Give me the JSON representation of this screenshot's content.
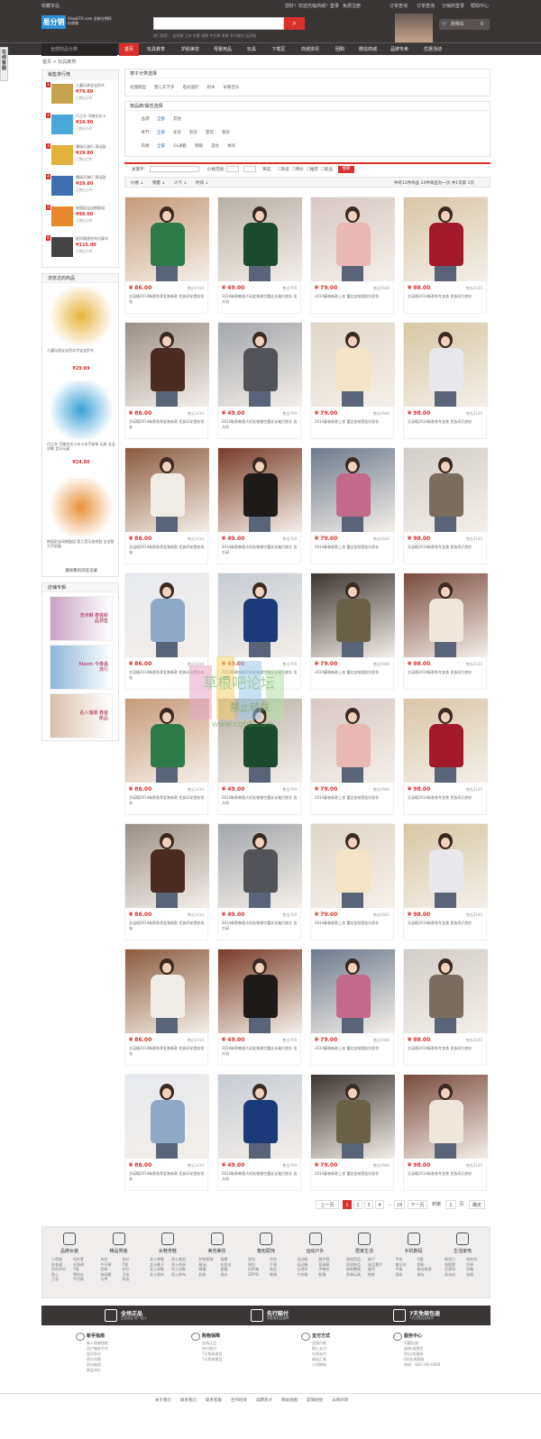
{
  "topbar": {
    "left": "收藏本站",
    "welcome": "您好！欢迎光临商城！",
    "login": "登录",
    "register": "免费注册",
    "order": "订单查询",
    "track": "订单查询",
    "distributor": "分销商登录",
    "help": "帮助中心"
  },
  "header": {
    "logo": "易分销",
    "logo_sub": "ShopEFX.com 全新分销科技商城",
    "search_placeholder": "",
    "hot_words": "热门搜索：  宝妈辅  卫衣  外套  裙装  牛仔裤  男装  多功能包  运动鞋",
    "cart_label": "购物车",
    "cart_count": "0"
  },
  "nav": {
    "category_label": "全部商品分类",
    "items": [
      "首页",
      "玩具教育",
      "护肤美容",
      "母婴用品",
      "玩具",
      "下载区",
      "商城资讯",
      "团购",
      "微信商城",
      "品牌专卖",
      "优惠活动"
    ]
  },
  "side_tab": "在线客服",
  "breadcrumb": "首页 > 玩具教育",
  "ranking": {
    "title": "销售排行榜",
    "items": [
      {
        "n": "1",
        "title": "儿童玩具宝宝积木",
        "price": "79.89",
        "sold": "已售出1件",
        "color": "#c6a24c"
      },
      {
        "n": "2",
        "title": "巧之木 可拖拉式小",
        "price": "24.90",
        "sold": "已售出1件",
        "color": "#4aa8d8"
      },
      {
        "n": "3",
        "title": "儒瑞天骑行 滑动鼓",
        "price": "29.80",
        "sold": "已售出1件",
        "color": "#e2b13a"
      },
      {
        "n": "4",
        "title": "儒瑞天骑行 滑动鼓",
        "price": "29.80",
        "sold": "已售出1件",
        "color": "#3e6fb0"
      },
      {
        "n": "5",
        "title": "南国彩宝动物鼓组",
        "price": "96.00",
        "sold": "已售出1件",
        "color": "#e88a2c"
      },
      {
        "n": "6",
        "title": "星阿模遥控车仿真车",
        "price": "115.00",
        "sold": "已售出1件",
        "color": "#444444"
      }
    ]
  },
  "viewed": {
    "title": "浏览过的商品",
    "items": [
      {
        "title": "儿童玩具宝宝积木字宝宝积木",
        "price": "¥29.89"
      },
      {
        "title": "巧之木 可拖拉式小木小木手敲琴 玩具 宝宝早教 音乐玩具",
        "price": "¥24.90"
      },
      {
        "title": "南国彩宝动物鼓组 婴儿音乐拍拍鼓 宝宝智力手拍鼓",
        "price": ""
      }
    ],
    "clear": "清除我的浏览记录"
  },
  "shops": {
    "title": "店铺专辑",
    "items": [
      "浩诗琳 春装新品预售",
      "fdaom 今春最流行",
      "名人瑞裳 春装新品"
    ]
  },
  "filter": {
    "cat_title": "按子分类选择",
    "cats": [
      "动漫模型",
      "婴儿车学步",
      "电动遥控",
      "积木",
      "早教音乐"
    ],
    "attr_title": "按品牌/属性选择",
    "rows": [
      {
        "k": "品牌：",
        "v": [
          "全部",
          "其他"
        ]
      },
      {
        "k": "季节：",
        "v": [
          "全部",
          "冬装",
          "秋装",
          "夏装",
          "春装"
        ]
      },
      {
        "k": "风格：",
        "v": [
          "全部",
          "OL通勤",
          "韩版",
          "淑女",
          "休闲"
        ]
      }
    ],
    "keyword_label": "关键字：",
    "price_label": "价格范围：",
    "filter_label": "筛选：",
    "checks": [
      "热卖",
      "特价",
      "推荐",
      "新品"
    ],
    "search_btn": "搜索"
  },
  "sort": {
    "items": [
      "价格",
      "销量",
      "人气",
      "时间"
    ],
    "summary": "共有12件商品 24件商品为一页 共1页第 1页"
  },
  "products": [
    {
      "price": "¥ 86.00",
      "sold": "售出1414",
      "desc": "艾诺格2014新款秋季女装新款 民族印花提花毛衣",
      "bg": "#c79a78",
      "cloth": "#2f7a4a"
    },
    {
      "price": "¥ 49.00",
      "sold": "售出769",
      "desc": "2014新款韩版大码女装镂空蕾丝长袖打底衫 女 大码",
      "bg": "#b8b0a6",
      "cloth": "#1c4a2f"
    },
    {
      "price": "¥ 79.00",
      "sold": "售出1640",
      "desc": "2014春装新款上衣 蕾丝女装宽松针织衫",
      "bg": "#d8c8c4",
      "cloth": "#e9b7b4"
    },
    {
      "price": "¥ 98.00",
      "sold": "售出2145",
      "desc": "艾诺格2014新款秋冬女装 民族风打底衫",
      "bg": "#d9c6a8",
      "cloth": "#a2182c"
    },
    {
      "price": "¥ 86.00",
      "sold": "售出1414",
      "desc": "艾诺格2014新款秋季女装新款 民族印花提花毛衣",
      "bg": "#9a8f86",
      "cloth": "#4a2c22"
    },
    {
      "price": "¥ 49.00",
      "sold": "售出769",
      "desc": "2014新款韩版大码女装镂空蕾丝长袖打底衫 女 大码",
      "bg": "#a3a6ab",
      "cloth": "#52545a"
    },
    {
      "price": "¥ 79.00",
      "sold": "售出1640",
      "desc": "2014春装新款上衣 蕾丝女装宽松针织衫",
      "bg": "#e0d6c8",
      "cloth": "#f2e4c4"
    },
    {
      "price": "¥ 98.00",
      "sold": "售出2145",
      "desc": "艾诺格2014新款秋冬女装 民族风打底衫",
      "bg": "#d6c7a4",
      "cloth": "#e8e8ec"
    },
    {
      "price": "¥ 86.00",
      "sold": "售出1414",
      "desc": "艾诺格2014新款秋季女装新款 民族印花提花毛衣",
      "bg": "#8c5a3c",
      "cloth": "#f0ece6"
    },
    {
      "price": "¥ 49.00",
      "sold": "售出769",
      "desc": "2014新款韩版大码女装镂空蕾丝长袖打底衫 女 大码",
      "bg": "#7a3c28",
      "cloth": "#1e1a1a"
    },
    {
      "price": "¥ 79.00",
      "sold": "售出1640",
      "desc": "2014春装新款上衣 蕾丝女装宽松针织衫",
      "bg": "#6d7a8c",
      "cloth": "#c26a8a"
    },
    {
      "price": "¥ 98.00",
      "sold": "售出2145",
      "desc": "艾诺格2014新款秋冬女装 民族风打底衫",
      "bg": "#d2cdc8",
      "cloth": "#7a6c5e"
    },
    {
      "price": "¥ 86.00",
      "sold": "售出1414",
      "desc": "艾诺格2014新款秋季女装新款 民族印花提花毛衣",
      "bg": "#e6e9ee",
      "cloth": "#8ea8c6"
    },
    {
      "price": "¥ 49.00",
      "sold": "售出769",
      "desc": "2014新款韩版大码女装镂空蕾丝长袖打底衫 女 大码",
      "bg": "#c6ccd4",
      "cloth": "#1c3a7a"
    },
    {
      "price": "¥ 79.00",
      "sold": "售出1640",
      "desc": "2014春装新款上衣 蕾丝女装宽松针织衫",
      "bg": "#3c3430",
      "cloth": "#6a6048"
    },
    {
      "price": "¥ 98.00",
      "sold": "售出2145",
      "desc": "艾诺格2014新款秋冬女装 民族风打底衫",
      "bg": "#7a4a3e",
      "cloth": "#efe6dc"
    },
    {
      "price": "¥ 86.00",
      "sold": "售出1414",
      "desc": "艾诺格2014新款秋季女装新款 民族印花提花毛衣",
      "bg": "#c79a78",
      "cloth": "#2f7a4a"
    },
    {
      "price": "¥ 49.00",
      "sold": "售出769",
      "desc": "2014新款韩版大码女装镂空蕾丝长袖打底衫 女 大码",
      "bg": "#b8b0a6",
      "cloth": "#1c4a2f"
    },
    {
      "price": "¥ 79.00",
      "sold": "售出1640",
      "desc": "2014春装新款上衣 蕾丝女装宽松针织衫",
      "bg": "#d8c8c4",
      "cloth": "#e9b7b4"
    },
    {
      "price": "¥ 98.00",
      "sold": "售出2145",
      "desc": "艾诺格2014新款秋冬女装 民族风打底衫",
      "bg": "#d9c6a8",
      "cloth": "#a2182c"
    },
    {
      "price": "¥ 86.00",
      "sold": "售出1414",
      "desc": "艾诺格2014新款秋季女装新款 民族印花提花毛衣",
      "bg": "#9a8f86",
      "cloth": "#4a2c22"
    },
    {
      "price": "¥ 49.00",
      "sold": "售出769",
      "desc": "2014新款韩版大码女装镂空蕾丝长袖打底衫 女 大码",
      "bg": "#a3a6ab",
      "cloth": "#52545a"
    },
    {
      "price": "¥ 79.00",
      "sold": "售出1640",
      "desc": "2014春装新款上衣 蕾丝女装宽松针织衫",
      "bg": "#e0d6c8",
      "cloth": "#f2e4c4"
    },
    {
      "price": "¥ 98.00",
      "sold": "售出2145",
      "desc": "艾诺格2014新款秋冬女装 民族风打底衫",
      "bg": "#d6c7a4",
      "cloth": "#e8e8ec"
    },
    {
      "price": "¥ 86.00",
      "sold": "售出1414",
      "desc": "艾诺格2014新款秋季女装新款 民族印花提花毛衣",
      "bg": "#8c5a3c",
      "cloth": "#f0ece6"
    },
    {
      "price": "¥ 49.00",
      "sold": "售出769",
      "desc": "2014新款韩版大码女装镂空蕾丝长袖打底衫 女 大码",
      "bg": "#7a3c28",
      "cloth": "#1e1a1a"
    },
    {
      "price": "¥ 79.00",
      "sold": "售出1640",
      "desc": "2014春装新款上衣 蕾丝女装宽松针织衫",
      "bg": "#6d7a8c",
      "cloth": "#c26a8a"
    },
    {
      "price": "¥ 98.00",
      "sold": "售出2145",
      "desc": "艾诺格2014新款秋冬女装 民族风打底衫",
      "bg": "#d2cdc8",
      "cloth": "#7a6c5e"
    },
    {
      "price": "¥ 86.00",
      "sold": "售出1414",
      "desc": "艾诺格2014新款秋季女装新款 民族印花提花毛衣",
      "bg": "#e6e9ee",
      "cloth": "#8ea8c6"
    },
    {
      "price": "¥ 49.00",
      "sold": "售出769",
      "desc": "2014新款韩版大码女装镂空蕾丝长袖打底衫 女 大码",
      "bg": "#c6ccd4",
      "cloth": "#1c3a7a"
    },
    {
      "price": "¥ 79.00",
      "sold": "售出1640",
      "desc": "2014春装新款上衣 蕾丝女装宽松针织衫",
      "bg": "#3c3430",
      "cloth": "#6a6048"
    },
    {
      "price": "¥ 98.00",
      "sold": "售出2145",
      "desc": "艾诺格2014新款秋冬女装 民族风打底衫",
      "bg": "#7a4a3e",
      "cloth": "#efe6dc"
    }
  ],
  "pager": {
    "prev": "上一页",
    "pages": [
      "1",
      "2",
      "3",
      "4"
    ],
    "ellipsis": "...",
    "last": "24",
    "next": "下一页",
    "goto": "到第",
    "page_input": "1",
    "page_unit": "页",
    "confirm": "确定"
  },
  "categories": [
    {
      "name": "品牌女装",
      "sub": [
        "小西装",
        "短外套",
        "连衣裙",
        "半身裙",
        "针织开衫",
        "T恤",
        "背心",
        "雪纺衫",
        "卫衣",
        "牛仔裤"
      ]
    },
    {
      "name": "精品男装",
      "sub": [
        "夹克",
        "毛衫",
        "牛仔裤",
        "T恤",
        "西装",
        "衬衫",
        "休闲裤",
        "卫衣",
        "马甲",
        "风衣"
      ]
    },
    {
      "name": "女鞋男鞋",
      "sub": [
        "女士单鞋",
        "男士商务",
        "女士靴子",
        "男士休闲",
        "女士凉鞋",
        "男士凉鞋",
        "女士帆布",
        "男士帆布"
      ]
    },
    {
      "name": "美容美妆",
      "sub": [
        "护肤套装",
        "面膜",
        "精油",
        "化妆水",
        "眼霜",
        "面霜",
        "彩妆",
        "香水"
      ]
    },
    {
      "name": "箱包配饰",
      "sub": [
        "女包",
        "男包",
        "钱包",
        "手表",
        "拉杆箱",
        "饰品",
        "ZIPPO",
        "眼镜"
      ]
    },
    {
      "name": "运动户外",
      "sub": [
        "运动鞋",
        "跑步鞋",
        "运动服",
        "篮球鞋",
        "山地车",
        "冲锋衣",
        "户外鞋",
        "帐篷"
      ]
    },
    {
      "name": "居家生活",
      "sub": [
        "厨房用品",
        "被子",
        "家居饰品",
        "床品套件",
        "收纳整理",
        "窗帘",
        "家装玩具",
        "抱枕"
      ]
    },
    {
      "name": "手机数码",
      "sub": [
        "手机",
        "U盘",
        "笔记本",
        "相机",
        "平板",
        "移动电源",
        "耳机",
        "鼠标"
      ]
    },
    {
      "name": "生活家电",
      "sub": [
        "剃须刀",
        "电吹风",
        "电饭煲",
        "空调",
        "豆浆机",
        "冰箱",
        "洗衣机",
        "电视"
      ]
    }
  ],
  "services": [
    {
      "a": "全场正品",
      "b": "正品保证 假一赔十"
    },
    {
      "a": "先行赔付",
      "b": "消费者权益保障"
    },
    {
      "a": "7天免邮包退",
      "b": "7天无理由退换货"
    }
  ],
  "help": [
    {
      "h": "新手指南",
      "l": [
        "新人购物指南",
        "用户服务平台",
        "会员积分",
        "积分兑换",
        "积分抽奖",
        "商品评价"
      ]
    },
    {
      "h": "购物保障",
      "l": [
        "全场正品",
        "先行赔付",
        "7天免邮退货",
        "7天免邮换货"
      ]
    },
    {
      "h": "支付方式",
      "l": [
        "货到付款",
        "网上支付",
        "在线支付",
        "邮局汇款",
        "公司转账"
      ]
    },
    {
      "h": "服务中心",
      "l": [
        "问题反馈",
        "返修/退换货",
        "积分/优惠券",
        "QQ在线客服",
        "热线：400-700-0000"
      ]
    }
  ],
  "footer": [
    "关于我们",
    "联系我们",
    "联系客服",
    "合作招商",
    "诚聘英才",
    "网站地图",
    "友情链接",
    "法律声明"
  ],
  "colors": {
    "accent": "#d9302b",
    "dark": "#3a3636",
    "link": "#2b6fb5"
  }
}
